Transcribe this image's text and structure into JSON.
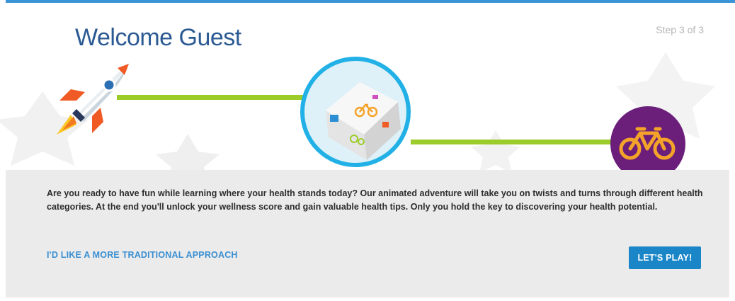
{
  "header": {
    "title": "Welcome Guest",
    "step": "Step 3 of 3"
  },
  "illustration": {
    "icons": [
      "rocket-icon",
      "cube-icon",
      "bicycle-icon"
    ],
    "colors": {
      "accent_blue": "#22b1e6",
      "track_green": "#9ccc2a",
      "bike_badge_purple": "#6b1f7a",
      "bike_orange": "#f4a32a"
    }
  },
  "body": {
    "intro": "Are you ready to have fun while learning where your health stands today? Our animated adventure will take you on twists and turns through different health categories. At the end you'll unlock your wellness score and gain valuable health tips. Only you hold the key to discovering your health potential.",
    "traditional_link": "I'D LIKE A MORE TRADITIONAL APPROACH",
    "play_button": "LET'S PLAY!"
  }
}
